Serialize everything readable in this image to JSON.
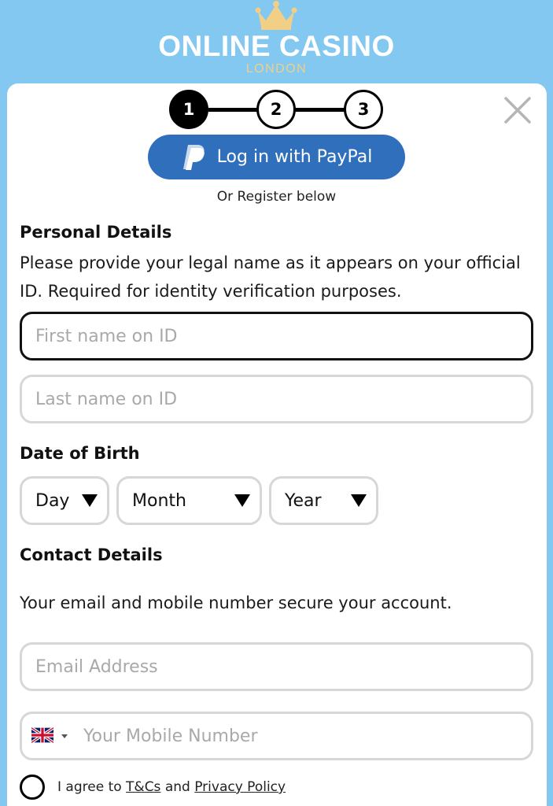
{
  "brand": {
    "title": "ONLINE CASINO",
    "subtitle": "LONDON"
  },
  "stepper": {
    "steps": [
      "1",
      "2",
      "3"
    ],
    "current": 1
  },
  "paypal": {
    "label": "Log in with PayPal"
  },
  "or_register": "Or Register below",
  "personal": {
    "heading": "Personal Details",
    "description": "Please provide your legal name as it appears on your official ID. Required for identity verification purposes.",
    "first_name_placeholder": "First name on ID",
    "last_name_placeholder": "Last name on ID"
  },
  "dob": {
    "heading": "Date of Birth",
    "day": "Day",
    "month": "Month",
    "year": "Year"
  },
  "contact": {
    "heading": "Contact Details",
    "description": "Your email and mobile number secure your account.",
    "email_placeholder": "Email Address",
    "mobile_placeholder": "Your Mobile Number",
    "country_flag": "uk-flag-icon"
  },
  "consent": {
    "prefix": "I agree to ",
    "terms": "T&Cs",
    "and": " and ",
    "privacy": "Privacy Policy"
  },
  "colors": {
    "background": "#83c8f1",
    "paypal_button": "#2f6fbc",
    "brand_gold": "#f1cf87",
    "field_border": "#d7d7d7"
  }
}
